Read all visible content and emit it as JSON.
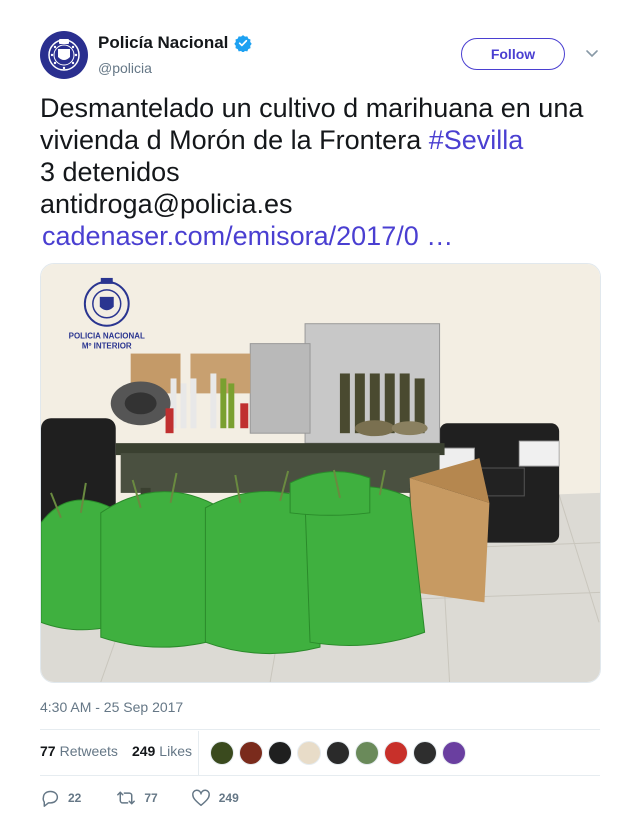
{
  "user": {
    "display_name": "Policía Nacional",
    "handle": "@policia",
    "verified": true,
    "avatar_logo_text": "POLICIA"
  },
  "follow_label": "Follow",
  "tweet": {
    "line1": "Desmantelado un cultivo d marihuana en una",
    "line2_text": "vivienda d Morón de la Frontera ",
    "hashtag": "#Sevilla",
    "line3": "3 detenidos",
    "line4": "antidroga@policia.es",
    "link": "cadenaser.com/emisora/2017/0  …"
  },
  "media": {
    "logo_line1": "POLICIA NACIONAL",
    "logo_line2": "Mº INTERIOR"
  },
  "timestamp": "4:30 AM - 25 Sep 2017",
  "stats": {
    "retweets_count": "77",
    "retweets_label": "Retweets",
    "likes_count": "249",
    "likes_label": "Likes"
  },
  "likers": [
    "#3a4a1e",
    "#7a2b1c",
    "#1f1f1f",
    "#e8dcc8",
    "#2a2a2a",
    "#6a8a5a",
    "#c8302a",
    "#2e2e2e",
    "#6a3fa0"
  ],
  "actions": {
    "reply_count": "22",
    "retweet_count": "77",
    "like_count": "249"
  },
  "colors": {
    "accent": "#4a3fd1",
    "verified": "#1da1f2",
    "muted": "#657786"
  }
}
